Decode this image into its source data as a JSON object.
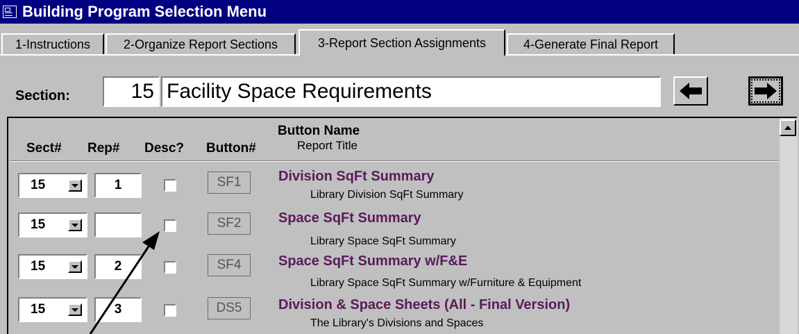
{
  "window": {
    "title": "Building Program Selection Menu"
  },
  "tabs": [
    {
      "label": "1-Instructions"
    },
    {
      "label": "2-Organize Report Sections"
    },
    {
      "label": "3-Report Section Assignments"
    },
    {
      "label": "4-Generate Final Report"
    }
  ],
  "section": {
    "label": "Section:",
    "number": "15",
    "title": "Facility Space Requirements"
  },
  "columns": {
    "sect": "Sect#",
    "rep": "Rep#",
    "desc": "Desc?",
    "button": "Button#",
    "name": "Button Name",
    "title": "Report Title"
  },
  "rows": [
    {
      "sect": "15",
      "rep": "1",
      "desc": false,
      "button": "SF1",
      "name": "Division SqFt Summary",
      "title": "Library Division SqFt Summary"
    },
    {
      "sect": "15",
      "rep": "",
      "desc": false,
      "button": "SF2",
      "name": "Space SqFt Summary",
      "title": "Library Space SqFt Summary"
    },
    {
      "sect": "15",
      "rep": "2",
      "desc": false,
      "button": "SF4",
      "name": "Space SqFt Summary w/F&E",
      "title": "Library Space SqFt Summary w/Furniture & Equipment"
    },
    {
      "sect": "15",
      "rep": "3",
      "desc": false,
      "button": "DS5",
      "name": "Division & Space Sheets (All - Final Version)",
      "title": "The Library's Divisions and Spaces"
    }
  ],
  "icons": {
    "back": "left-arrow-icon",
    "forward": "right-arrow-icon",
    "window": "form-icon"
  }
}
